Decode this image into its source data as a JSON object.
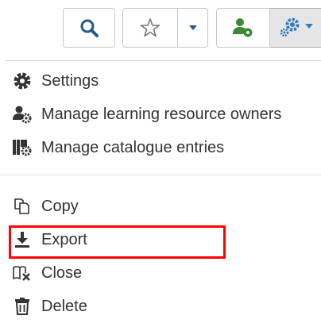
{
  "toolbar": {
    "search_icon": "search-icon",
    "bookmark_icon": "star-icon",
    "bookmark_dropdown_icon": "caret-down-icon",
    "owners_icon": "user-settings-icon",
    "tools_icon": "gears-icon",
    "tools_dropdown_icon": "caret-down-icon"
  },
  "menu": {
    "group1": [
      {
        "label": "Settings",
        "icon": "gear-icon"
      },
      {
        "label": "Manage learning resource owners",
        "icon": "user-gear-icon"
      },
      {
        "label": "Manage catalogue entries",
        "icon": "catalogue-icon"
      }
    ],
    "group2": [
      {
        "label": "Copy",
        "icon": "copy-icon"
      },
      {
        "label": "Export",
        "icon": "download-icon"
      },
      {
        "label": "Close",
        "icon": "close-book-icon"
      },
      {
        "label": "Delete",
        "icon": "trash-icon"
      }
    ]
  },
  "colors": {
    "search_blue": "#1f5a8a",
    "owners_green": "#3b8a34",
    "tools_blue": "#2f7cc0",
    "highlight_red": "#ff0000"
  }
}
